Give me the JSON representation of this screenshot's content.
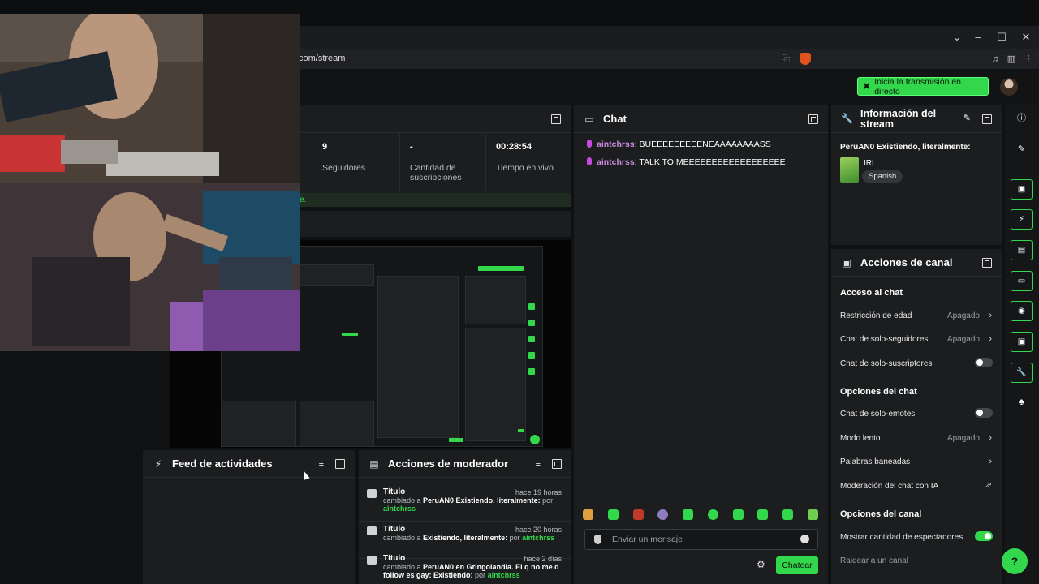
{
  "browser": {
    "url": "com/stream",
    "window_controls": [
      "chevron",
      "minimize",
      "maximize",
      "close"
    ]
  },
  "header": {
    "go_live_label": "Inicia la transmisión en directo"
  },
  "stats": {
    "items": [
      {
        "value": "9",
        "label": "Seguidores"
      },
      {
        "value": "-",
        "label": "Cantidad de suscripciones"
      },
      {
        "value": "00:28:54",
        "label": "Tiempo en vivo"
      }
    ],
    "note": "e."
  },
  "chat": {
    "title": "Chat",
    "messages": [
      {
        "user": "aintchrss",
        "text": "BUEEEEEEEEENEAAAAAAAASS"
      },
      {
        "user": "aintchrss",
        "text": "TALK TO MEEEEEEEEEEEEEEEEEE"
      }
    ],
    "input_placeholder": "Enviar un mensaje",
    "send_label": "Chatear"
  },
  "stream_info": {
    "title": "Información del stream",
    "stream_title": "PeruAN0 Existiendo, literalmente:",
    "category": "IRL",
    "language": "Spanish"
  },
  "channel_actions": {
    "title": "Acciones de canal",
    "sections": [
      {
        "title": "Acceso al chat",
        "rows": [
          {
            "label": "Restricción de edad",
            "value": "Apagado",
            "kind": "chevron"
          },
          {
            "label": "Chat de solo-seguidores",
            "value": "Apagado",
            "kind": "chevron"
          },
          {
            "label": "Chat de solo-suscriptores",
            "value": "",
            "kind": "toggle-off"
          }
        ]
      },
      {
        "title": "Opciones del chat",
        "rows": [
          {
            "label": "Chat de solo-emotes",
            "value": "",
            "kind": "toggle-off"
          },
          {
            "label": "Modo lento",
            "value": "Apagado",
            "kind": "chevron"
          },
          {
            "label": "Palabras baneadas",
            "value": "",
            "kind": "chevron"
          },
          {
            "label": "Moderación del chat con IA",
            "value": "",
            "kind": "external"
          }
        ]
      },
      {
        "title": "Opciones del canal",
        "rows": [
          {
            "label": "Mostrar cantidad de espectadores",
            "value": "",
            "kind": "toggle-on"
          },
          {
            "label": "Raidear a un canal",
            "value": "",
            "kind": "plain"
          }
        ]
      }
    ]
  },
  "activity_feed": {
    "title": "Feed de actividades"
  },
  "mod_actions": {
    "title": "Acciones de moderador",
    "items": [
      {
        "title": "Título",
        "time": "hace 19 horas",
        "prefix": "cambiado a",
        "value": "PeruAN0 Existiendo, literalmente:",
        "by": "por",
        "user": "aintchrss"
      },
      {
        "title": "Título",
        "time": "hace 20 horas",
        "prefix": "cambiado a",
        "value": "Existiendo, literalmente:",
        "by": "por",
        "user": "aintchrss"
      },
      {
        "title": "Título",
        "time": "hace 2 días",
        "prefix": "cambiado a",
        "value": "PeruAN0 en Gringolandia. El q no me d follow es gay: Existiendo:",
        "by": "por",
        "user": "aintchrss"
      }
    ]
  },
  "colors": {
    "accent": "#32d74b",
    "panel": "#1b1d1f",
    "background": "#0f1112",
    "username": "#c78ce0"
  }
}
